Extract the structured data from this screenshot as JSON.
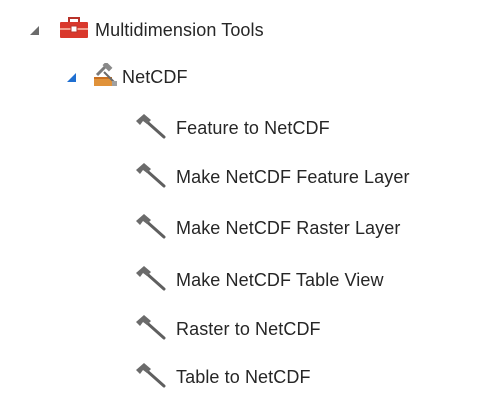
{
  "tree": {
    "root": {
      "label": "Multidimension Tools",
      "icon": "toolbox-icon",
      "expanded": true,
      "children": {
        "netcdf": {
          "label": "NetCDF",
          "icon": "toolset-icon",
          "expanded": true,
          "tools": [
            {
              "label": "Feature to NetCDF",
              "icon": "hammer-icon"
            },
            {
              "label": "Make NetCDF Feature Layer",
              "icon": "hammer-icon"
            },
            {
              "label": "Make NetCDF Raster Layer",
              "icon": "hammer-icon"
            },
            {
              "label": "Make NetCDF Table View",
              "icon": "hammer-icon"
            },
            {
              "label": "Raster to NetCDF",
              "icon": "hammer-icon"
            },
            {
              "label": "Table to NetCDF",
              "icon": "hammer-icon"
            }
          ]
        }
      }
    }
  },
  "colors": {
    "toolbox_red": "#d9382c",
    "toolset_orange": "#e0923a",
    "expander_blue": "#1f6fd1",
    "hammer_gray": "#6b6b6b"
  }
}
